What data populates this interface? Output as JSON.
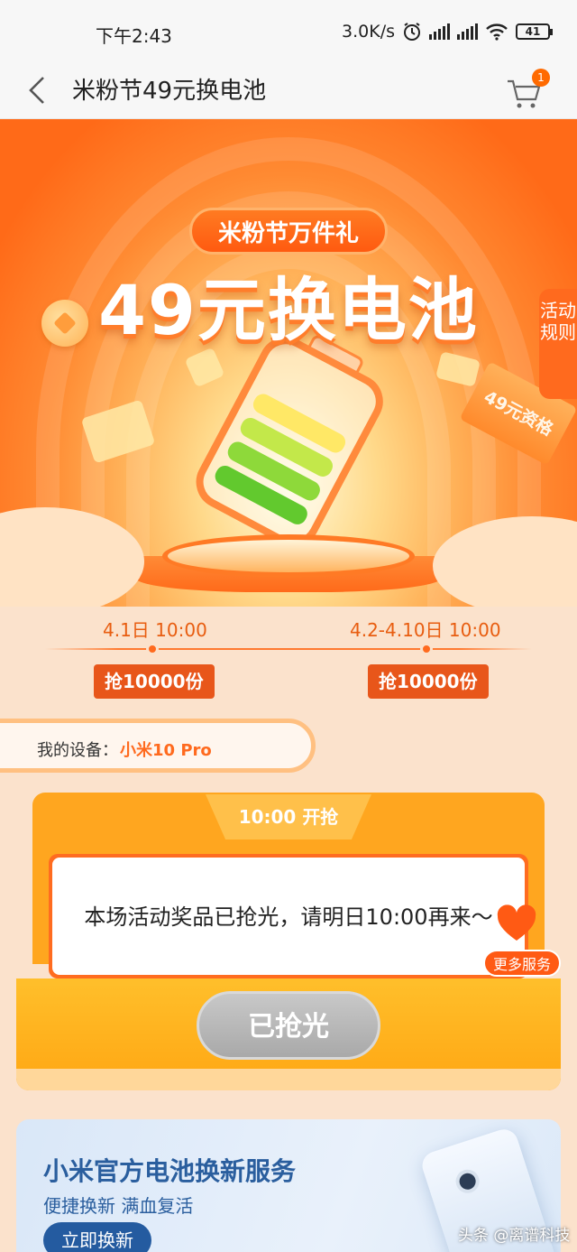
{
  "status_bar": {
    "time": "下午2:43",
    "network_speed": "3.0K/s",
    "battery": "41"
  },
  "nav": {
    "title": "米粉节49元换电池",
    "cart_badge": "1"
  },
  "hero": {
    "badge": "米粉节万件礼",
    "title": "49元换电池",
    "rules_label": "活动规则",
    "ticket_label": "49元资格"
  },
  "timeline": [
    {
      "time": "4.1日 10:00",
      "tag": "抢10000份"
    },
    {
      "time": "4.2-4.10日 10:00",
      "tag": "抢10000份"
    }
  ],
  "device": {
    "label": "我的设备：",
    "value": "小米10 Pro"
  },
  "card": {
    "tab": "10:00 开抢",
    "message": "本场活动奖品已抢光，请明日10:00再来～",
    "button": "已抢光",
    "more_service": "更多服务"
  },
  "banner": {
    "title": "小米官方电池换新服务",
    "subtitle": "便捷换新 满血复活",
    "button": "立即换新"
  },
  "watermark": "头条 @离谱科技",
  "colors": {
    "accent": "#ff6a1e",
    "brand_blue": "#245ba0",
    "card_yellow": "#ffa61f"
  }
}
